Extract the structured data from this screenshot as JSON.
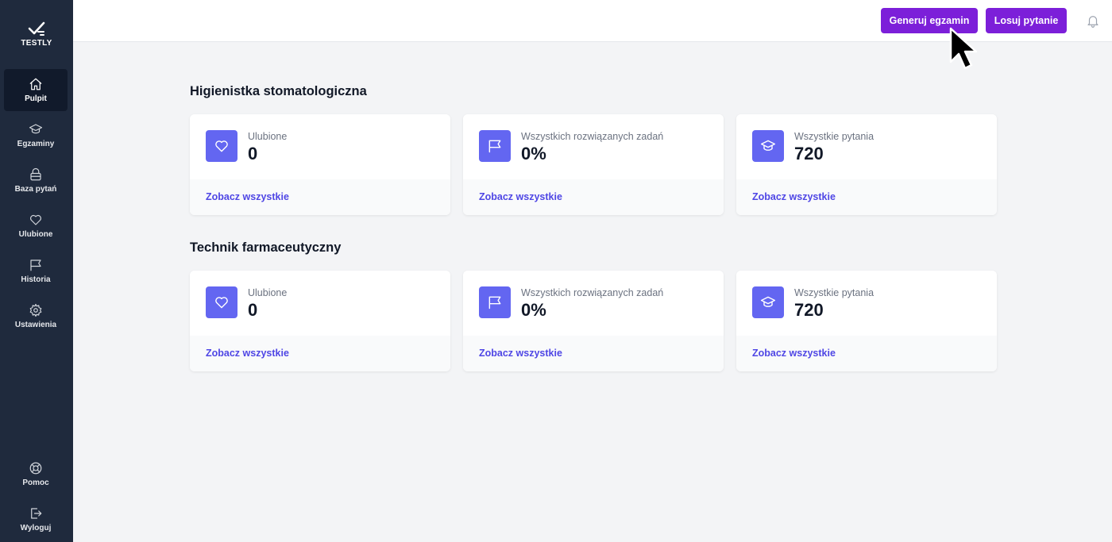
{
  "app": {
    "logo_text": "TESTLY"
  },
  "sidebar": {
    "items": [
      {
        "label": "Pulpit",
        "icon": "home-icon",
        "active": true
      },
      {
        "label": "Egzaminy",
        "icon": "academic-cap-icon"
      },
      {
        "label": "Baza pytań",
        "icon": "archive-icon"
      },
      {
        "label": "Ulubione",
        "icon": "heart-icon"
      },
      {
        "label": "Historia",
        "icon": "flag-icon"
      },
      {
        "label": "Ustawienia",
        "icon": "gear-icon"
      }
    ],
    "bottom_items": [
      {
        "label": "Pomoc",
        "icon": "lifebuoy-icon"
      },
      {
        "label": "Wyloguj",
        "icon": "logout-icon"
      }
    ]
  },
  "header": {
    "generate_exam_label": "Generuj egzamin",
    "random_question_label": "Losuj pytanie",
    "accent_color": "#7c1fd9"
  },
  "sections": [
    {
      "title": "Higienistka stomatologiczna",
      "cards": [
        {
          "label": "Ulubione",
          "value": "0",
          "link": "Zobacz wszystkie",
          "icon": "heart-icon"
        },
        {
          "label": "Wszystkich rozwiązanych zadań",
          "value": "0%",
          "link": "Zobacz wszystkie",
          "icon": "flag-icon"
        },
        {
          "label": "Wszystkie pytania",
          "value": "720",
          "link": "Zobacz wszystkie",
          "icon": "academic-cap-icon"
        }
      ]
    },
    {
      "title": "Technik farmaceutyczny",
      "cards": [
        {
          "label": "Ulubione",
          "value": "0",
          "link": "Zobacz wszystkie",
          "icon": "heart-icon"
        },
        {
          "label": "Wszystkich rozwiązanych zadań",
          "value": "0%",
          "link": "Zobacz wszystkie",
          "icon": "flag-icon"
        },
        {
          "label": "Wszystkie pytania",
          "value": "720",
          "link": "Zobacz wszystkie",
          "icon": "academic-cap-icon"
        }
      ]
    }
  ],
  "colors": {
    "sidebar_bg": "#1f2a3d",
    "icon_bg": "#6366f1",
    "link": "#4f46e5"
  }
}
